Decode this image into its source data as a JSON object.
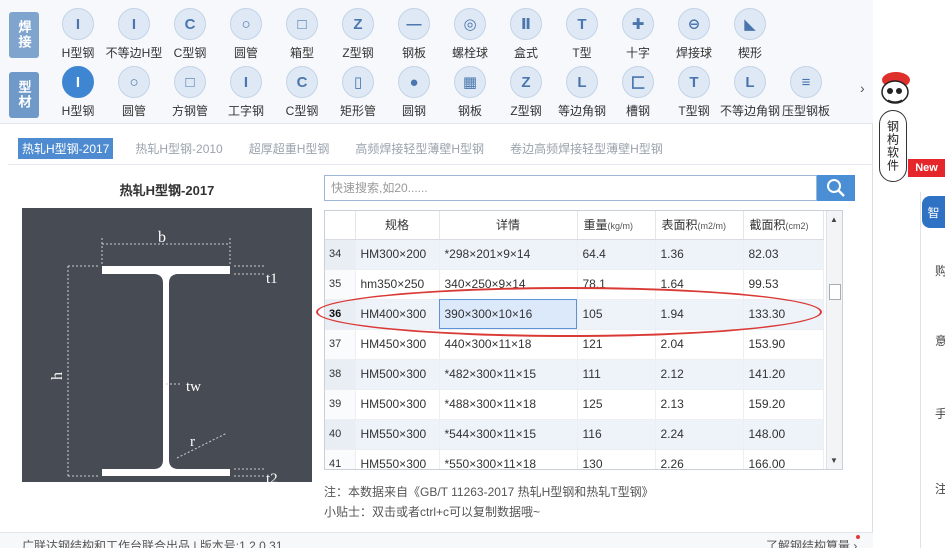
{
  "palette": {
    "group1_label": "焊接",
    "group2_label": "型材",
    "row1": [
      {
        "label": "H型钢",
        "icon": "I-beam-icon",
        "glyph": "I"
      },
      {
        "label": "不等边H型",
        "icon": "unequal-h-icon",
        "glyph": "I"
      },
      {
        "label": "C型钢",
        "icon": "c-channel-icon",
        "glyph": "C"
      },
      {
        "label": "圆管",
        "icon": "round-tube-icon",
        "glyph": "○"
      },
      {
        "label": "箱型",
        "icon": "box-section-icon",
        "glyph": "□"
      },
      {
        "label": "Z型钢",
        "icon": "z-section-icon",
        "glyph": "Z"
      },
      {
        "label": "钢板",
        "icon": "plate-icon",
        "glyph": "—"
      },
      {
        "label": "螺栓球",
        "icon": "bolt-ball-icon",
        "glyph": "◎"
      },
      {
        "label": "盒式",
        "icon": "box-type-icon",
        "glyph": "Ⅱ"
      },
      {
        "label": "T型",
        "icon": "t-section-icon",
        "glyph": "T"
      },
      {
        "label": "十字",
        "icon": "cross-section-icon",
        "glyph": "✚"
      },
      {
        "label": "焊接球",
        "icon": "welded-ball-icon",
        "glyph": "⊖"
      },
      {
        "label": "楔形",
        "icon": "wedge-icon",
        "glyph": "◣"
      }
    ],
    "row2": [
      {
        "label": "H型钢",
        "icon": "I-beam-icon",
        "glyph": "I",
        "active": true
      },
      {
        "label": "圆管",
        "icon": "round-tube-icon",
        "glyph": "○"
      },
      {
        "label": "方钢管",
        "icon": "square-tube-icon",
        "glyph": "□"
      },
      {
        "label": "工字钢",
        "icon": "i-steel-icon",
        "glyph": "I"
      },
      {
        "label": "C型钢",
        "icon": "c-channel-icon",
        "glyph": "C"
      },
      {
        "label": "矩形管",
        "icon": "rect-tube-icon",
        "glyph": "▯"
      },
      {
        "label": "圆钢",
        "icon": "round-bar-icon",
        "glyph": "●"
      },
      {
        "label": "钢板",
        "icon": "plate-icon",
        "glyph": "▦"
      },
      {
        "label": "Z型钢",
        "icon": "z-section-icon",
        "glyph": "Z"
      },
      {
        "label": "等边角钢",
        "icon": "equal-angle-icon",
        "glyph": "L"
      },
      {
        "label": "槽钢",
        "icon": "channel-icon",
        "glyph": "匚"
      },
      {
        "label": "T型钢",
        "icon": "t-section-icon",
        "glyph": "T"
      },
      {
        "label": "不等边角钢",
        "icon": "unequal-angle-icon",
        "glyph": "L"
      },
      {
        "label": "压型钢板",
        "icon": "profiled-plate-icon",
        "glyph": "≡"
      }
    ],
    "more_glyph": "›"
  },
  "subtabs": [
    {
      "label": "热轧H型钢-2017",
      "active": true
    },
    {
      "label": "热轧H型钢-2010"
    },
    {
      "label": "超厚超重H型钢"
    },
    {
      "label": "高频焊接轻型薄壁H型钢"
    },
    {
      "label": "卷边高频焊接轻型薄壁H型钢"
    }
  ],
  "section_title": "热轧H型钢-2017",
  "diagram": {
    "b": "b",
    "h": "h",
    "t1": "t1",
    "t2": "t2",
    "tw": "tw",
    "r": "r"
  },
  "search": {
    "placeholder": "快速搜索,如20......"
  },
  "table": {
    "headers": {
      "spec": "规格",
      "detail": "详情",
      "weight": "重量",
      "weight_unit": "(kg/m)",
      "surface": "表面积",
      "surface_unit": "(m2/m)",
      "section": "截面积",
      "section_unit": "(cm2)"
    },
    "rows": [
      {
        "idx": "34",
        "spec": "HM300×200",
        "detail": "*298×201×9×14",
        "weight": "64.4",
        "surface": "1.36",
        "section": "82.03"
      },
      {
        "idx": "35",
        "spec": "hm350×250",
        "detail": "340×250×9×14",
        "weight": "78.1",
        "surface": "1.64",
        "section": "99.53"
      },
      {
        "idx": "36",
        "spec": "HM400×300",
        "detail": "390×300×10×16",
        "weight": "105",
        "surface": "1.94",
        "section": "133.30",
        "selected": true
      },
      {
        "idx": "37",
        "spec": "HM450×300",
        "detail": "440×300×11×18",
        "weight": "121",
        "surface": "2.04",
        "section": "153.90"
      },
      {
        "idx": "38",
        "spec": "HM500×300",
        "detail": "*482×300×11×15",
        "weight": "111",
        "surface": "2.12",
        "section": "141.20"
      },
      {
        "idx": "39",
        "spec": "HM500×300",
        "detail": "*488×300×11×18",
        "weight": "125",
        "surface": "2.13",
        "section": "159.20"
      },
      {
        "idx": "40",
        "spec": "HM550×300",
        "detail": "*544×300×11×15",
        "weight": "116",
        "surface": "2.24",
        "section": "148.00"
      },
      {
        "idx": "41",
        "spec": "HM550×300",
        "detail": "*550×300×11×18",
        "weight": "130",
        "surface": "2.26",
        "section": "166.00"
      }
    ]
  },
  "note": "注：本数据来自《GB/T 11263-2017 热轧H型钢和热轧T型钢》",
  "tip": "小贴士：双击或者ctrl+c可以复制数据哦~",
  "footer": {
    "left": "广联达钢结构和工作台联合出品 | 版本号:1.2.0.31",
    "right": "了解钢结构算量",
    "right_arrow": "›"
  },
  "side": {
    "mascot_text": "钢构软件",
    "new_badge": "New",
    "tab_char": "智",
    "chars": [
      "购",
      "意",
      "手",
      "注"
    ]
  },
  "colors": {
    "accent": "#4e8bd0",
    "highlight_ring": "#d93a36",
    "diagram_bg": "#474b53"
  }
}
